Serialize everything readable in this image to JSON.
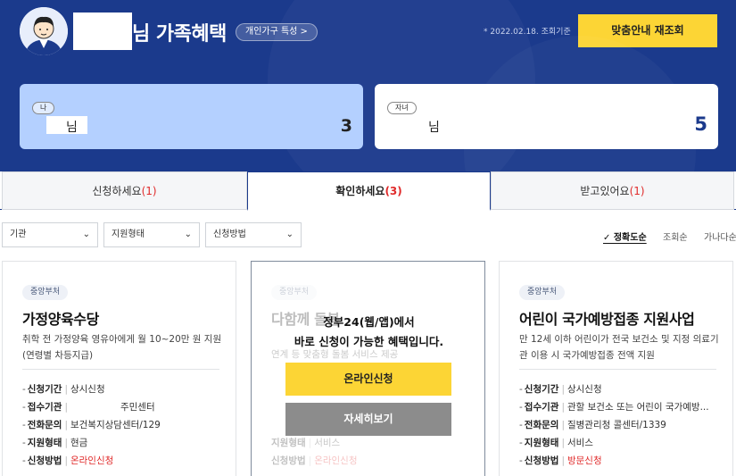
{
  "header": {
    "title": "님 가족혜택",
    "trait_button": "개인가구 특성 >",
    "date_note": "* 2022.02.18. 조회기준",
    "recheck_button": "맞춤안내 재조회"
  },
  "members": [
    {
      "tag": "나",
      "name_suffix": "님",
      "count": "3"
    },
    {
      "tag": "자녀",
      "name_suffix": "님",
      "count": "5"
    }
  ],
  "tabs": [
    {
      "label": "신청하세요",
      "count": "(1)"
    },
    {
      "label": "확인하세요",
      "count": "(3)"
    },
    {
      "label": "받고있어요",
      "count": "(1)"
    }
  ],
  "filters": [
    {
      "label": "기관"
    },
    {
      "label": "지원형태"
    },
    {
      "label": "신청방법"
    }
  ],
  "sort": {
    "options": [
      "✓ 정확도순",
      "조회순",
      "가나다순"
    ]
  },
  "row_labels": {
    "period": "신청기간",
    "agency": "접수기관",
    "phone": "전화문의",
    "type": "지원형태",
    "method": "신청방법"
  },
  "cards": [
    {
      "chip": "중앙부처",
      "title": "가정양육수당",
      "desc": "취학 전 가정양육 영유아에게 월 10~20만 원 지원(연령별 차등지급)",
      "period": "상시신청",
      "agency": "주민센터",
      "phone": "보건복지상담센터/129",
      "type": "현금",
      "method": "온라인신청"
    },
    {
      "chip": "중앙부처",
      "title": "다함께 돌봄",
      "desc": "연계 등 맞춤형 돌봄 서비스 제공",
      "type": "서비스",
      "method": "온라인신청",
      "overlay_line1": "정부24(웹/앱)에서",
      "overlay_line2": "바로 신청이 가능한 혜택입니다.",
      "online_button": "온라인신청",
      "detail_button": "자세히보기"
    },
    {
      "chip": "중앙부처",
      "title": "어린이 국가예방접종 지원사업",
      "desc": "만 12세 이하 어린이가 전국 보건소 및 지정 의료기관 이용 시 국가예방접종 전액 지원",
      "period": "상시신청",
      "agency": "관할 보건소 또는 어린이 국가예방...",
      "phone": "질병관리청 콜센터/1339",
      "type": "서비스",
      "method": "방문신청"
    }
  ],
  "colors": {
    "header_bg": "#1b3a8c",
    "accent_yellow": "#fcd535",
    "me_card": "#b4d0ff",
    "count_red": "#e02b2b"
  }
}
